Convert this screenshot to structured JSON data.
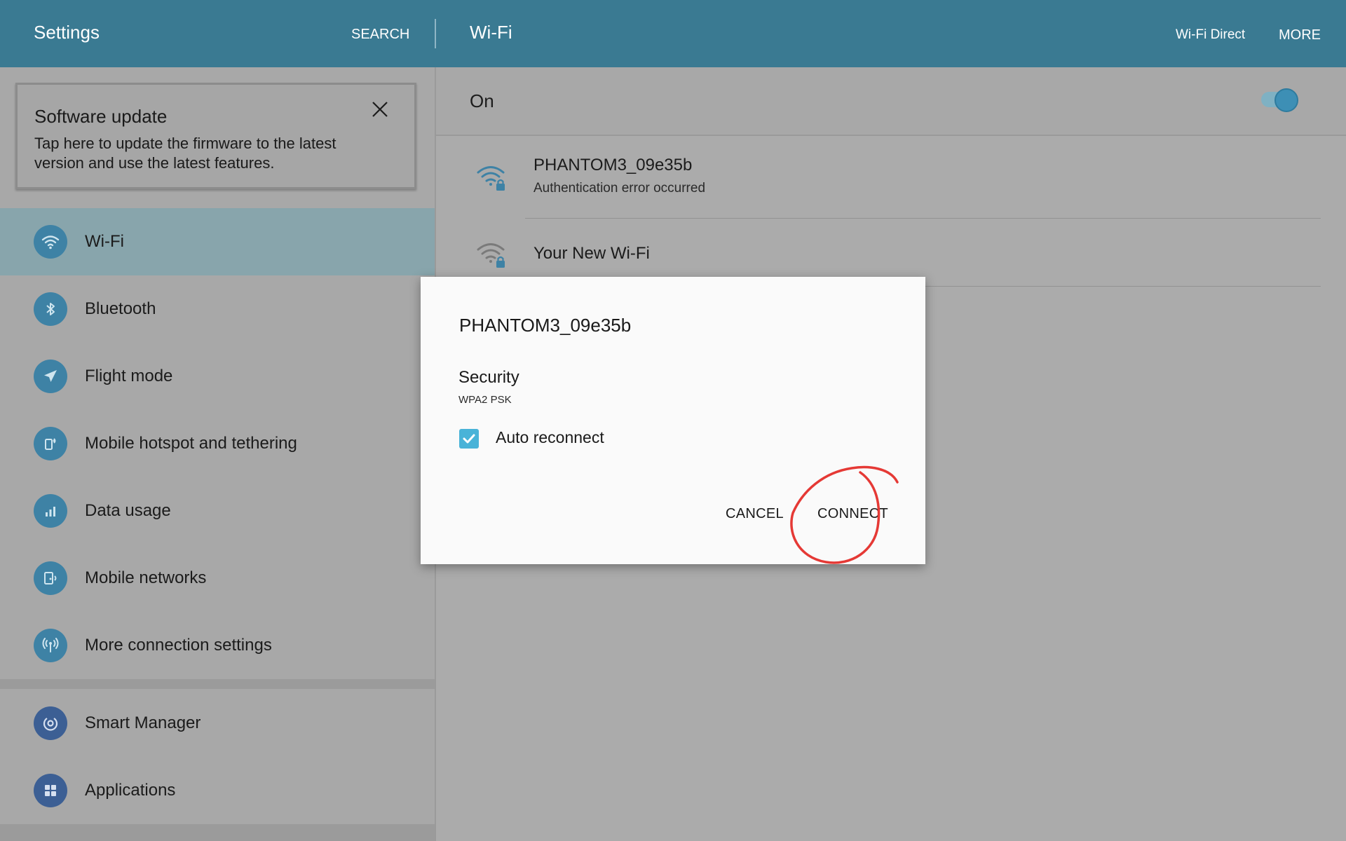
{
  "header": {
    "settings_title": "Settings",
    "search_label": "SEARCH",
    "page_title": "Wi-Fi",
    "wifi_direct_label": "Wi-Fi Direct",
    "more_label": "MORE"
  },
  "update_card": {
    "title": "Software update",
    "description": "Tap here to update the firmware to the latest version and use the latest features."
  },
  "sidebar": {
    "items": [
      {
        "label": "Wi-Fi",
        "icon": "wifi-icon",
        "selected": true
      },
      {
        "label": "Bluetooth",
        "icon": "bluetooth-icon"
      },
      {
        "label": "Flight mode",
        "icon": "airplane-icon"
      },
      {
        "label": "Mobile hotspot and tethering",
        "icon": "hotspot-icon"
      },
      {
        "label": "Data usage",
        "icon": "data-usage-icon"
      },
      {
        "label": "Mobile networks",
        "icon": "mobile-networks-icon"
      },
      {
        "label": "More connection settings",
        "icon": "connection-settings-icon"
      },
      {
        "label": "Smart Manager",
        "icon": "smart-manager-icon"
      },
      {
        "label": "Applications",
        "icon": "applications-icon"
      }
    ]
  },
  "wifi": {
    "toggle_label": "On",
    "toggle_on": true,
    "networks": [
      {
        "name": "PHANTOM3_09e35b",
        "status": "Authentication error occurred",
        "secured": true
      },
      {
        "name": "Your New Wi-Fi",
        "secured": true
      }
    ]
  },
  "dialog": {
    "title": "PHANTOM3_09e35b",
    "security_label": "Security",
    "security_value": "WPA2 PSK",
    "auto_reconnect_label": "Auto reconnect",
    "auto_reconnect_checked": true,
    "cancel_label": "CANCEL",
    "connect_label": "CONNECT"
  },
  "colors": {
    "header": "#3a7a92",
    "accent": "#3e82a5",
    "checkbox": "#49b3d8",
    "annotation": "#e53935"
  }
}
